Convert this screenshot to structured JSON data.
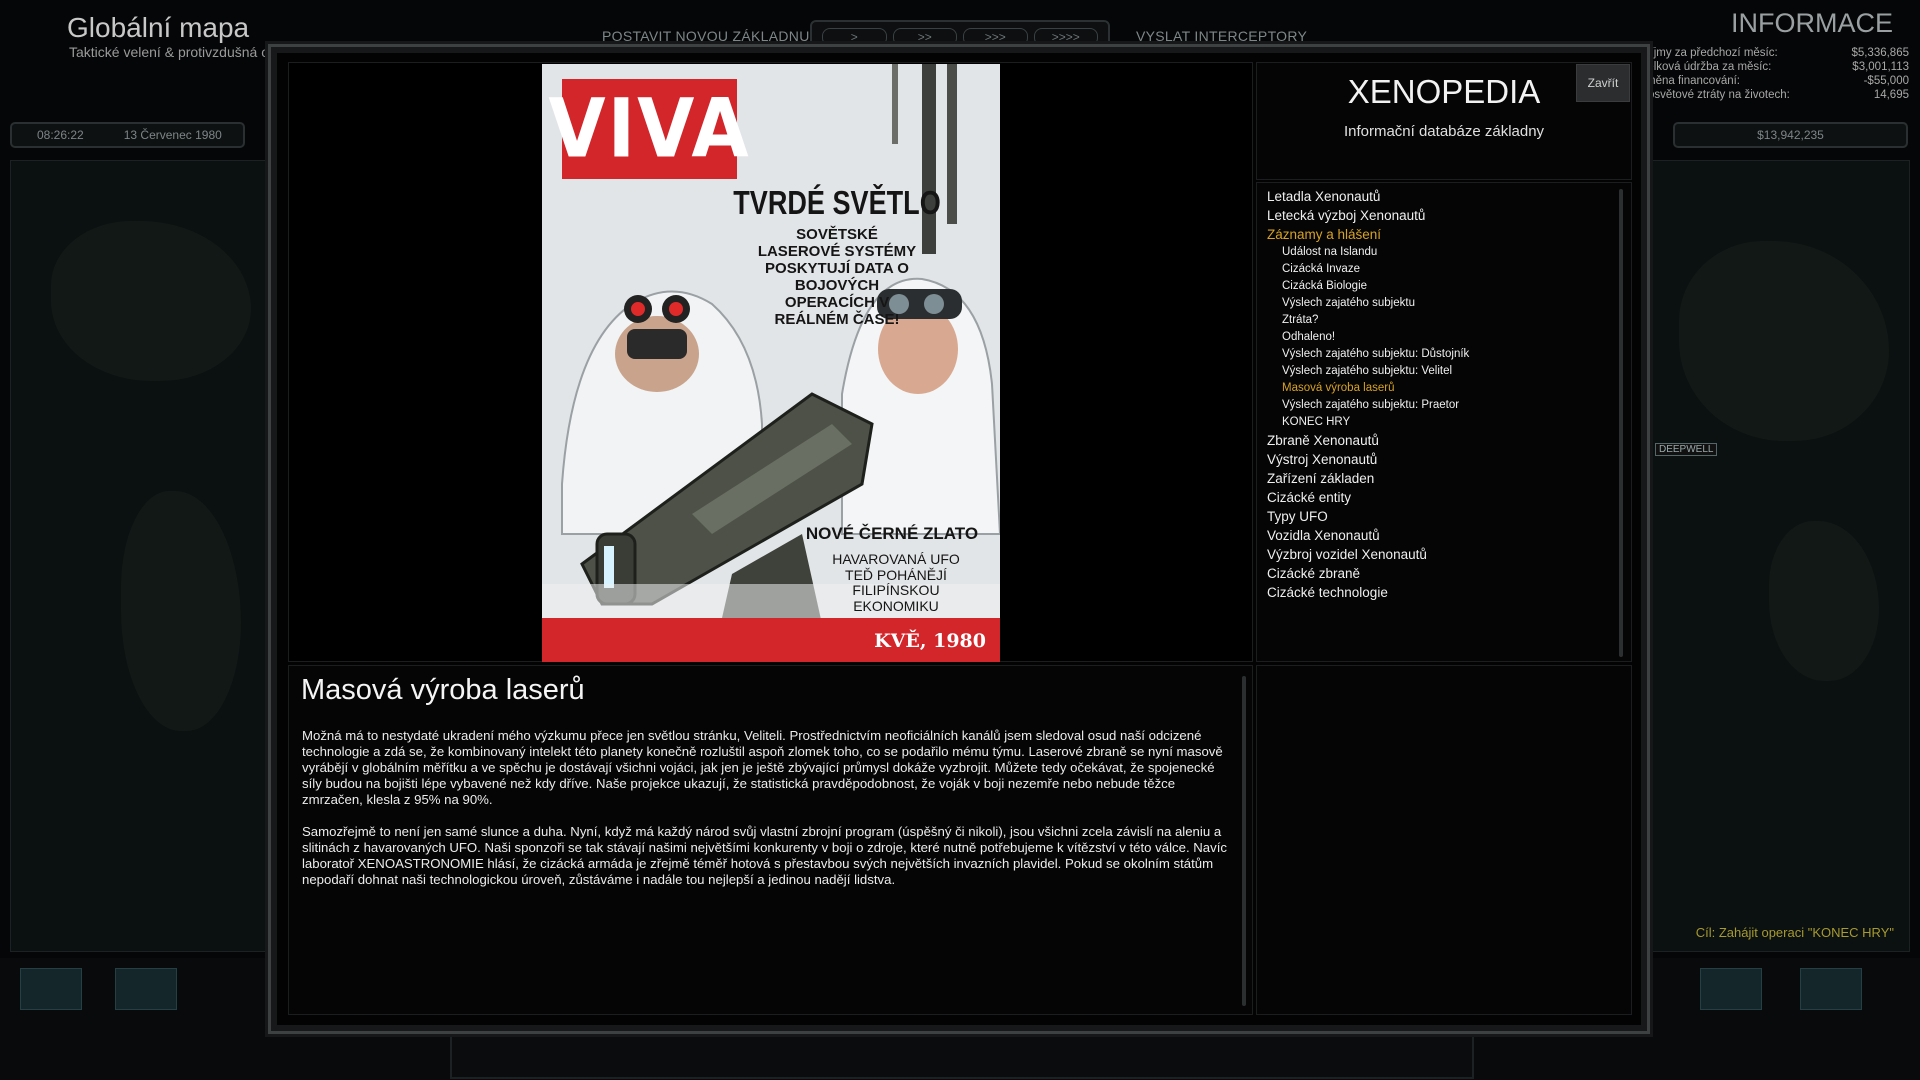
{
  "background": {
    "title": "Globální mapa",
    "subtitle": "Taktické velení & protivzdušná ol",
    "build_base_label": "POSTAVIT NOVOU ZÁKLADNU",
    "send_interceptors_label": "VYSLAT INTERCEPTORY",
    "speed_buttons": [
      ">",
      ">>",
      ">>>",
      ">>>>"
    ],
    "clock": "08:26:22",
    "date": "13 Červenec 1980",
    "info_title": "INFORMACE",
    "stats": [
      {
        "label": "Příjmy za předchozí měsíc:",
        "value": "$5,336,865"
      },
      {
        "label": "Celková údržba za měsíc:",
        "value": "$3,001,113"
      },
      {
        "label": "Změna financování:",
        "value": "-$55,000"
      },
      {
        "label": "elosvětové ztráty na životech:",
        "value": "14,695"
      }
    ],
    "funds": "$13,942,235",
    "map_label": "DEEPWELL",
    "objective": "Cíl: Zahájit operaci \"KONEC HRY\""
  },
  "xenopedia": {
    "title": "XENOPEDIA",
    "subtitle": "Informační databáze základny",
    "close_label": "Zavřít",
    "items": [
      {
        "label": "Letadla Xenonautů"
      },
      {
        "label": "Letecká výzboj Xenonautů"
      },
      {
        "label": "Záznamy a hlášení"
      },
      {
        "label": "Událost na Islandu"
      },
      {
        "label": "Cizácká Invaze"
      },
      {
        "label": "Cizácká Biologie"
      },
      {
        "label": "Výslech zajatého subjektu"
      },
      {
        "label": "Ztráta?"
      },
      {
        "label": "Odhaleno!"
      },
      {
        "label": "Výslech zajatého subjektu: Důstojník"
      },
      {
        "label": "Výslech zajatého subjektu: Velitel"
      },
      {
        "label": "Masová výroba laserů"
      },
      {
        "label": "Výslech zajatého subjektu: Praetor"
      },
      {
        "label": "KONEC HRY"
      },
      {
        "label": "Zbraně Xenonautů"
      },
      {
        "label": "Výstroj Xenonautů"
      },
      {
        "label": "Zařízení základen"
      },
      {
        "label": "Cizácké entity"
      },
      {
        "label": "Typy UFO"
      },
      {
        "label": "Vozidla Xenonautů"
      },
      {
        "label": "Výzbroj vozidel Xenonautů"
      },
      {
        "label": "Cizácké zbraně"
      },
      {
        "label": "Cizácké technologie"
      }
    ]
  },
  "article": {
    "title": "Masová výroba laserů",
    "paragraphs": [
      "Možná má to nestydaté ukradení mého výzkumu přece jen světlou stránku, Veliteli. Prostřednictvím neoficiálních kanálů jsem sledoval osud naší odcizené technologie a zdá se, že kombinovaný intelekt této planety konečně rozluštil aspoň zlomek toho, co se podařilo mému týmu. Laserové zbraně se nyní masově vyrábějí v globálním měřítku a ve spěchu je dostávají všichni vojáci, jak jen je ještě zbývající průmysl dokáže vyzbrojit. Můžete tedy očekávat, že spojenecké síly budou na bojišti lépe vybavené než kdy dříve. Naše projekce ukazují, že statistická pravděpodobnost, že voják v boji nezemře nebo nebude těžce zmrzačen, klesla z 95% na 90%.",
      "Samozřejmě to není jen samé slunce a duha. Nyní, když má každý národ svůj vlastní zbrojní program (úspěšný či nikoli), jsou všichni zcela závislí na aleniu a slitinách z havarovaných UFO. Naši sponzoři se tak stávají našimi největšími konkurenty v boji o zdroje, které nutně potřebujeme k vítězství v této válce. Navíc laboratoř XENOASTRONOMIE hlásí, že cizácká armáda je zřejmě téměř hotová s přestavbou svých největších invazních plavidel. Pokud se okolním státům nepodaří dohnat naši technologickou úroveň, zůstáváme i nadále tou nejlepší a jedinou nadějí lidstva."
    ]
  },
  "cover": {
    "logo": "VIVA",
    "headline": "TVRDÉ SVĚTLO",
    "deck": "SOVĚTSKÉ\nLASEROVÉ SYSTÉMY\nPOSKYTUJÍ DATA O\nBOJOVÝCH\nOPERACÍCH V\nREÁLNÉM ČASE!",
    "headline2": "NOVÉ ČERNÉ ZLATO",
    "deck2": "HAVAROVANÁ UFO\nTEĎ POHÁNĚJÍ\nFILIPÍNSKOU\nEKONOMIKU",
    "issue_date": "KVĚ, 1980"
  }
}
